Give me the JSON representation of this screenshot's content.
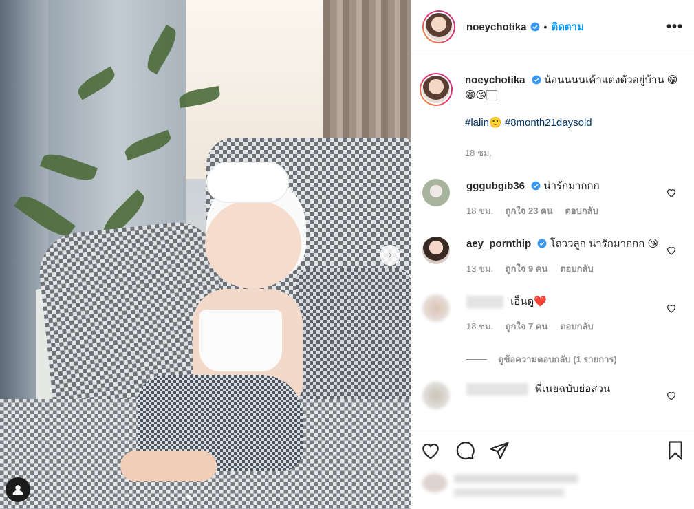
{
  "post": {
    "username": "noeychotika",
    "follow_label": "ติดตาม",
    "separator": "•",
    "more_icon": "more-icon",
    "caption_text": "น้อนนนนเค้าแต่งตัวอยู่บ้าน 😁😁😘🏻",
    "hashtags": [
      "#lalin🙂",
      "#8month21daysold"
    ],
    "caption_time": "18 ชม."
  },
  "comments": [
    {
      "username": "gggubgib36",
      "text": "น่ารักมากกก",
      "time": "18 ชม.",
      "likes": "ถูกใจ 23 คน",
      "reply_label": "ตอบกลับ",
      "verified": true
    },
    {
      "username": "aey_pornthip",
      "text": "โถววลูก น่ารักมากกก 😘",
      "time": "13 ชม.",
      "likes": "ถูกใจ 9 คน",
      "reply_label": "ตอบกลับ",
      "verified": true
    },
    {
      "username": "",
      "text": "เอ็นดู❤️",
      "time": "18 ชม.",
      "likes": "ถูกใจ 7 คน",
      "reply_label": "ตอบกลับ",
      "verified": false
    },
    {
      "username": "",
      "text": "พี่เนยฉบับย่อส่วน",
      "time": "",
      "likes": "",
      "reply_label": "",
      "verified": false
    }
  ],
  "view_replies": "ดูข้อความตอบกลับ (1 รายการ)",
  "colors": {
    "link": "#0095f6",
    "hashtag": "#00376b",
    "muted": "#8e8e8e",
    "verified": "#3897f0"
  }
}
